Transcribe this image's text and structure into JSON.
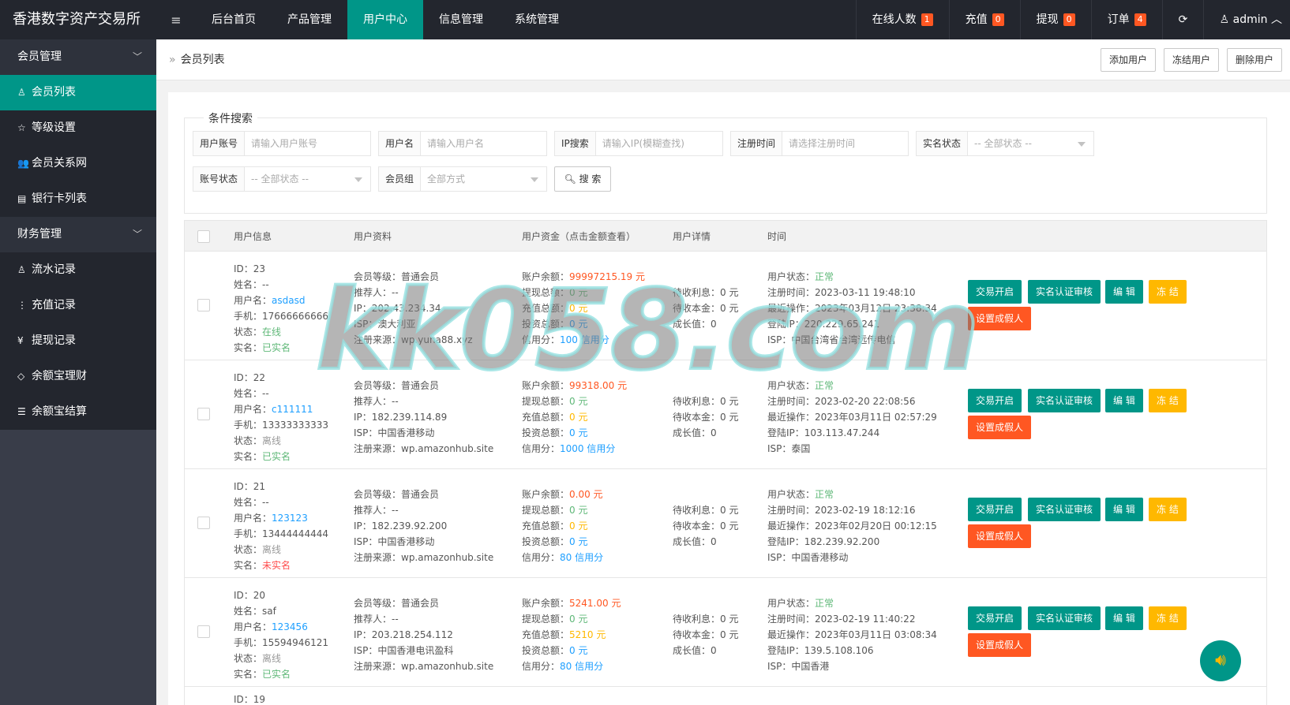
{
  "app": {
    "title": "香港数字资产交易所",
    "flex_icon": "≡"
  },
  "topnav": [
    {
      "label": "后台首页"
    },
    {
      "label": "产品管理"
    },
    {
      "label": "用户中心"
    },
    {
      "label": "信息管理"
    },
    {
      "label": "系统管理"
    }
  ],
  "topright": {
    "online": {
      "label": "在线人数",
      "count": "1"
    },
    "recharge": {
      "label": "充值",
      "count": "0"
    },
    "withdraw": {
      "label": "提现",
      "count": "0"
    },
    "order": {
      "label": "订单",
      "count": "4"
    },
    "refresh_icon": "⟳",
    "user": "admin",
    "user_icon": "user-icon"
  },
  "sidebar": {
    "groups": [
      {
        "label": "会员管理",
        "items": [
          {
            "label": "会员列表",
            "icon": "user-icon",
            "glyph": "♙"
          },
          {
            "label": "等级设置",
            "icon": "star-icon",
            "glyph": "☆"
          },
          {
            "label": "会员关系网",
            "icon": "users-icon",
            "glyph": "👥"
          },
          {
            "label": "银行卡列表",
            "icon": "card-icon",
            "glyph": "▤"
          }
        ]
      },
      {
        "label": "财务管理",
        "items": [
          {
            "label": "流水记录",
            "icon": "user-icon",
            "glyph": "♙"
          },
          {
            "label": "充值记录",
            "icon": "more-icon",
            "glyph": "⋮"
          },
          {
            "label": "提现记录",
            "icon": "yen-icon",
            "glyph": "¥"
          },
          {
            "label": "余额宝理财",
            "icon": "diamond-icon",
            "glyph": "◇"
          },
          {
            "label": "余额宝结算",
            "icon": "list-icon",
            "glyph": "☰"
          }
        ]
      }
    ]
  },
  "breadcrumb": {
    "label": "会员列表"
  },
  "toolbar": {
    "add": "添加用户",
    "freeze": "冻结用户",
    "delete": "删除用户"
  },
  "search": {
    "legend": "条件搜索",
    "fields": [
      {
        "label": "用户账号",
        "placeholder": "请输入用户账号"
      },
      {
        "label": "用户名",
        "placeholder": "请输入用户名"
      },
      {
        "label": "IP搜索",
        "placeholder": "请输入IP(模糊查找)"
      },
      {
        "label": "注册时间",
        "placeholder": "请选择注册时间"
      },
      {
        "label": "实名状态",
        "placeholder": "-- 全部状态 --"
      },
      {
        "label": "账号状态",
        "placeholder": "-- 全部状态 --"
      },
      {
        "label": "会员组",
        "placeholder": "全部方式"
      }
    ],
    "button": "搜 索"
  },
  "table": {
    "headers": [
      "用户信息",
      "用户资料",
      "用户资金（点击金额查看）",
      "用户详情",
      "时间"
    ],
    "rows": [
      {
        "info": [
          "ID：23",
          "姓名：--",
          "用户名：",
          "asdasd",
          "手机：17666666666",
          "状态：",
          "在线",
          "实名：",
          "已实名"
        ],
        "profile": [
          "会员等级：普通会员",
          "推荐人：--",
          "IP：202.43.234.34",
          "ISP：澳大利亚",
          "注册来源：wp.yuna88.xyz"
        ],
        "funds": [
          "账户余额：",
          "99997215.19 元",
          "提现总额：",
          "0 元",
          "充值总额：",
          "0 元",
          "投资总额：",
          "0 元",
          "信用分：",
          "100 信用分"
        ],
        "detail": [
          "待收利息：0 元",
          "待收本金：0 元",
          "成长值：0"
        ],
        "time": [
          "用户状态：",
          "正常",
          "注册时间：2023-03-11 19:48:10",
          "最近操作：2023年03月12日 23:38:34",
          "登陆IP：220.229.65.241",
          "ISP：中国台湾省台湾远传电信"
        ]
      },
      {
        "info": [
          "ID：22",
          "姓名：--",
          "用户名：",
          "c111111",
          "手机：13333333333",
          "状态：",
          "离线",
          "实名：",
          "已实名"
        ],
        "profile": [
          "会员等级：普通会员",
          "推荐人：--",
          "IP：182.239.114.89",
          "ISP：中国香港移动",
          "注册来源：wp.amazonhub.site"
        ],
        "funds": [
          "账户余额：",
          "99318.00 元",
          "提现总额：",
          "0 元",
          "充值总额：",
          "0 元",
          "投资总额：",
          "0 元",
          "信用分：",
          "1000 信用分"
        ],
        "detail": [
          "待收利息：0 元",
          "待收本金：0 元",
          "成长值：0"
        ],
        "time": [
          "用户状态：",
          "正常",
          "注册时间：2023-02-20 22:08:56",
          "最近操作：2023年03月11日 02:57:29",
          "登陆IP：103.113.47.244",
          "ISP：泰国"
        ]
      },
      {
        "info": [
          "ID：21",
          "姓名：--",
          "用户名：",
          "123123",
          "手机：13444444444",
          "状态：",
          "离线",
          "实名：",
          "未实名"
        ],
        "profile": [
          "会员等级：普通会员",
          "推荐人：--",
          "IP：182.239.92.200",
          "ISP：中国香港移动",
          "注册来源：wp.amazonhub.site"
        ],
        "funds": [
          "账户余额：",
          "0.00 元",
          "提现总额：",
          "0 元",
          "充值总额：",
          "0 元",
          "投资总额：",
          "0 元",
          "信用分：",
          "80 信用分"
        ],
        "detail": [
          "待收利息：0 元",
          "待收本金：0 元",
          "成长值：0"
        ],
        "time": [
          "用户状态：",
          "正常",
          "注册时间：2023-02-19 18:12:16",
          "最近操作：2023年02月20日 00:12:15",
          "登陆IP：182.239.92.200",
          "ISP：中国香港移动"
        ]
      },
      {
        "info": [
          "ID：20",
          "姓名：saf",
          "用户名：",
          "123456",
          "手机：15594946121",
          "状态：",
          "离线",
          "实名：",
          "已实名"
        ],
        "profile": [
          "会员等级：普通会员",
          "推荐人：--",
          "IP：203.218.254.112",
          "ISP：中国香港电讯盈科",
          "注册来源：wp.amazonhub.site"
        ],
        "funds": [
          "账户余额：",
          "5241.00 元",
          "提现总额：",
          "0 元",
          "充值总额：",
          "5210 元",
          "投资总额：",
          "0 元",
          "信用分：",
          "80 信用分"
        ],
        "detail": [
          "待收利息：0 元",
          "待收本金：0 元",
          "成长值：0"
        ],
        "time": [
          "用户状态：",
          "正常",
          "注册时间：2023-02-19 11:40:22",
          "最近操作：2023年03月11日 03:08:34",
          "登陆IP：139.5.108.106",
          "ISP：中国香港"
        ]
      }
    ],
    "partial_row": "ID：19",
    "actions": {
      "trade": "交易开启",
      "verify": "实名认证审核",
      "edit": "编 辑",
      "freeze": "冻 结",
      "fake": "设置成假人"
    }
  },
  "watermark": "kk058.com",
  "float_icon": "speaker-icon",
  "colors": {
    "accent": "#009688",
    "header": "#23262e",
    "sidebar": "#393d49",
    "badge": "#ff5722",
    "warn": "#ffb800"
  }
}
